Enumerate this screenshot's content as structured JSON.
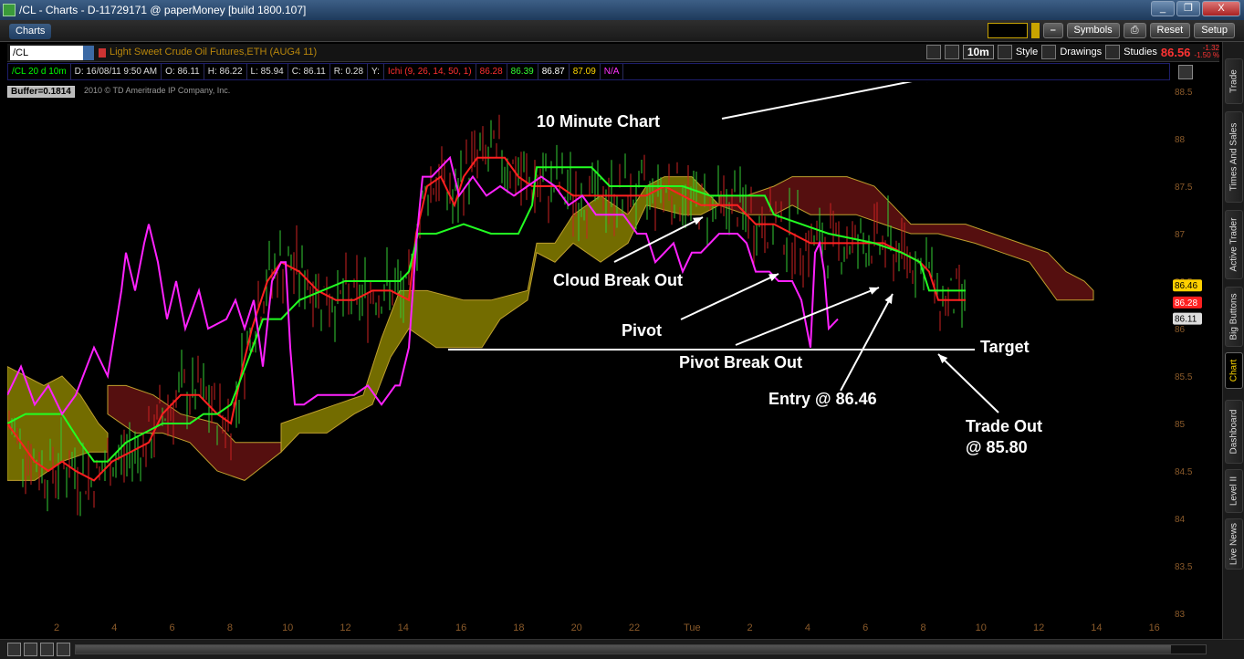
{
  "window": {
    "title": "/CL - Charts - D-11729171 @ paperMoney [build 1800.107]",
    "buttons": [
      "_",
      "❐",
      "X"
    ]
  },
  "app_toolbar": {
    "tab": "Charts",
    "symbols_label": "Symbols",
    "reset_label": "Reset",
    "setup_label": "Setup"
  },
  "symbol_bar": {
    "symbol": "/CL",
    "description": "Light Sweet Crude Oil Futures,ETH (AUG4 11)",
    "timeframe": "10m",
    "style_label": "Style",
    "drawings_label": "Drawings",
    "studies_label": "Studies",
    "last_price": "86.56",
    "change": "-1.32",
    "change_pct": "-1.50 %"
  },
  "info_bar": {
    "chart_label": "/CL 20 d 10m",
    "date": "D: 16/08/11 9:50 AM",
    "open": "O: 86.11",
    "high": "H: 86.22",
    "low": "L: 85.94",
    "close": "C: 86.11",
    "range": "R: 0.28",
    "y": "Y:",
    "study": "Ichi (9, 26, 14, 50, 1)",
    "v1": "86.28",
    "v2": "86.39",
    "v3": "86.87",
    "v4": "87.09",
    "v5": "N/A"
  },
  "chart_meta": {
    "buffer": "Buffer=0.1814",
    "copyright": "2010 © TD Ameritrade IP Company, Inc."
  },
  "annotations": {
    "title": "10 Minute Chart",
    "cloud_break": "Cloud Break Out",
    "pivot": "Pivot",
    "pivot_break": "Pivot Break Out",
    "entry": "Entry @ 86.46",
    "target": "Target",
    "trade_out_1": "Trade Out",
    "trade_out_2": "@ 85.80"
  },
  "price_tags": [
    "86.46",
    "86.28",
    "86.11"
  ],
  "colors": {
    "accent": "#3b5c83",
    "tenkan": "#ff2020",
    "kijun": "#22ff22",
    "chikou": "#ff22ff",
    "cloud_bull": "#7a7200",
    "cloud_bear": "#5a1010"
  },
  "side_tabs": [
    "Trade",
    "Times And Sales",
    "Active Trader",
    "Big Buttons",
    "Chart",
    "Dashboard",
    "Level II",
    "Live News"
  ],
  "chart_data": {
    "type": "line",
    "y_ticks": [
      "88.5",
      "88",
      "87.5",
      "87",
      "86.5",
      "86",
      "85.5",
      "85",
      "84.5",
      "84",
      "83.5",
      "83"
    ],
    "x_ticks": [
      "2",
      "4",
      "6",
      "8",
      "10",
      "12",
      "14",
      "16",
      "18",
      "20",
      "22",
      "Tue",
      "2",
      "4",
      "6",
      "8",
      "10",
      "12",
      "14",
      "16"
    ],
    "ylim": [
      83,
      88.6
    ],
    "series": [
      {
        "name": "",
        "color": "#ff2020",
        "points": [
          [
            0,
            85.0
          ],
          [
            15,
            84.8
          ],
          [
            30,
            84.6
          ],
          [
            45,
            84.5
          ],
          [
            60,
            84.6
          ],
          [
            75,
            84.5
          ],
          [
            95,
            84.4
          ],
          [
            115,
            84.6
          ],
          [
            135,
            84.7
          ],
          [
            155,
            84.8
          ],
          [
            170,
            85.1
          ],
          [
            190,
            85.3
          ],
          [
            210,
            85.3
          ],
          [
            230,
            85.1
          ],
          [
            245,
            85.0
          ],
          [
            258,
            85.6
          ],
          [
            268,
            86.0
          ],
          [
            285,
            86.5
          ],
          [
            300,
            86.7
          ],
          [
            320,
            86.6
          ],
          [
            340,
            86.4
          ],
          [
            360,
            86.3
          ],
          [
            380,
            86.3
          ],
          [
            400,
            86.4
          ],
          [
            420,
            86.4
          ],
          [
            440,
            86.3
          ],
          [
            448,
            87.0
          ],
          [
            460,
            87.5
          ],
          [
            475,
            87.6
          ],
          [
            490,
            87.3
          ],
          [
            500,
            87.6
          ],
          [
            515,
            87.8
          ],
          [
            530,
            87.8
          ],
          [
            545,
            87.8
          ],
          [
            560,
            87.6
          ],
          [
            575,
            87.5
          ],
          [
            590,
            87.5
          ],
          [
            605,
            87.5
          ],
          [
            620,
            87.4
          ],
          [
            640,
            87.4
          ],
          [
            660,
            87.4
          ],
          [
            680,
            87.4
          ],
          [
            700,
            87.4
          ],
          [
            720,
            87.5
          ],
          [
            740,
            87.4
          ],
          [
            760,
            87.3
          ],
          [
            780,
            87.3
          ],
          [
            800,
            87.3
          ],
          [
            820,
            87.1
          ],
          [
            840,
            87.1
          ],
          [
            860,
            87.0
          ],
          [
            880,
            86.9
          ],
          [
            900,
            86.9
          ],
          [
            920,
            86.9
          ],
          [
            940,
            86.9
          ],
          [
            960,
            86.9
          ],
          [
            980,
            86.8
          ],
          [
            1000,
            86.7
          ],
          [
            1010,
            86.6
          ],
          [
            1020,
            86.3
          ],
          [
            1035,
            86.3
          ],
          [
            1050,
            86.3
          ]
        ]
      },
      {
        "name": "",
        "color": "#22ff22",
        "points": [
          [
            0,
            85.0
          ],
          [
            20,
            85.1
          ],
          [
            40,
            85.1
          ],
          [
            60,
            85.1
          ],
          [
            80,
            84.8
          ],
          [
            95,
            84.6
          ],
          [
            110,
            84.6
          ],
          [
            130,
            84.8
          ],
          [
            150,
            84.9
          ],
          [
            170,
            85.0
          ],
          [
            200,
            85.0
          ],
          [
            215,
            85.1
          ],
          [
            230,
            85.1
          ],
          [
            245,
            85.2
          ],
          [
            265,
            85.7
          ],
          [
            280,
            86.1
          ],
          [
            300,
            86.1
          ],
          [
            320,
            86.3
          ],
          [
            345,
            86.4
          ],
          [
            370,
            86.5
          ],
          [
            400,
            86.5
          ],
          [
            430,
            86.5
          ],
          [
            440,
            86.6
          ],
          [
            450,
            87.0
          ],
          [
            470,
            87.0
          ],
          [
            500,
            87.1
          ],
          [
            530,
            87.0
          ],
          [
            560,
            87.0
          ],
          [
            575,
            87.3
          ],
          [
            580,
            87.7
          ],
          [
            610,
            87.7
          ],
          [
            640,
            87.7
          ],
          [
            660,
            87.5
          ],
          [
            700,
            87.5
          ],
          [
            740,
            87.5
          ],
          [
            770,
            87.4
          ],
          [
            800,
            87.4
          ],
          [
            830,
            87.4
          ],
          [
            840,
            87.2
          ],
          [
            870,
            87.1
          ],
          [
            900,
            87.0
          ],
          [
            950,
            86.9
          ],
          [
            980,
            86.8
          ],
          [
            1000,
            86.7
          ],
          [
            1010,
            86.4
          ],
          [
            1050,
            86.4
          ]
        ]
      },
      {
        "name": "",
        "color": "#ff22ff",
        "points": [
          [
            0,
            85.3
          ],
          [
            15,
            85.6
          ],
          [
            30,
            85.2
          ],
          [
            45,
            85.4
          ],
          [
            60,
            85.1
          ],
          [
            75,
            85.3
          ],
          [
            95,
            85.8
          ],
          [
            110,
            85.5
          ],
          [
            125,
            86.4
          ],
          [
            130,
            86.8
          ],
          [
            140,
            86.4
          ],
          [
            150,
            86.9
          ],
          [
            155,
            87.1
          ],
          [
            165,
            86.7
          ],
          [
            175,
            86.1
          ],
          [
            185,
            86.5
          ],
          [
            195,
            86.0
          ],
          [
            210,
            86.4
          ],
          [
            220,
            86.0
          ],
          [
            240,
            86.1
          ],
          [
            250,
            86.3
          ],
          [
            260,
            86.0
          ],
          [
            270,
            86.3
          ],
          [
            280,
            85.6
          ],
          [
            290,
            86.5
          ],
          [
            300,
            86.7
          ],
          [
            305,
            86.7
          ],
          [
            310,
            85.8
          ],
          [
            315,
            85.2
          ],
          [
            325,
            85.2
          ],
          [
            340,
            85.3
          ],
          [
            360,
            85.3
          ],
          [
            380,
            85.3
          ],
          [
            395,
            85.4
          ],
          [
            410,
            85.2
          ],
          [
            425,
            85.4
          ],
          [
            430,
            85.4
          ],
          [
            440,
            85.8
          ],
          [
            448,
            86.9
          ],
          [
            455,
            87.6
          ],
          [
            465,
            87.6
          ],
          [
            475,
            87.7
          ],
          [
            485,
            87.8
          ],
          [
            495,
            87.4
          ],
          [
            510,
            87.6
          ],
          [
            525,
            87.4
          ],
          [
            540,
            87.5
          ],
          [
            555,
            87.4
          ],
          [
            570,
            87.5
          ],
          [
            585,
            87.6
          ],
          [
            600,
            87.5
          ],
          [
            615,
            87.3
          ],
          [
            630,
            87.4
          ],
          [
            645,
            87.2
          ],
          [
            660,
            87.2
          ],
          [
            675,
            87.2
          ],
          [
            690,
            87.0
          ],
          [
            700,
            87.0
          ],
          [
            710,
            86.7
          ],
          [
            720,
            86.8
          ],
          [
            730,
            86.9
          ],
          [
            740,
            86.6
          ],
          [
            750,
            86.8
          ],
          [
            760,
            86.8
          ],
          [
            770,
            86.9
          ],
          [
            780,
            87.0
          ],
          [
            790,
            87.0
          ],
          [
            800,
            87.0
          ],
          [
            810,
            86.9
          ],
          [
            820,
            86.6
          ],
          [
            835,
            86.6
          ],
          [
            845,
            86.5
          ],
          [
            860,
            86.5
          ],
          [
            870,
            86.3
          ],
          [
            880,
            85.8
          ],
          [
            885,
            86.8
          ],
          [
            890,
            86.9
          ],
          [
            895,
            86.6
          ],
          [
            900,
            86.0
          ],
          [
            910,
            86.1
          ]
        ]
      }
    ]
  }
}
